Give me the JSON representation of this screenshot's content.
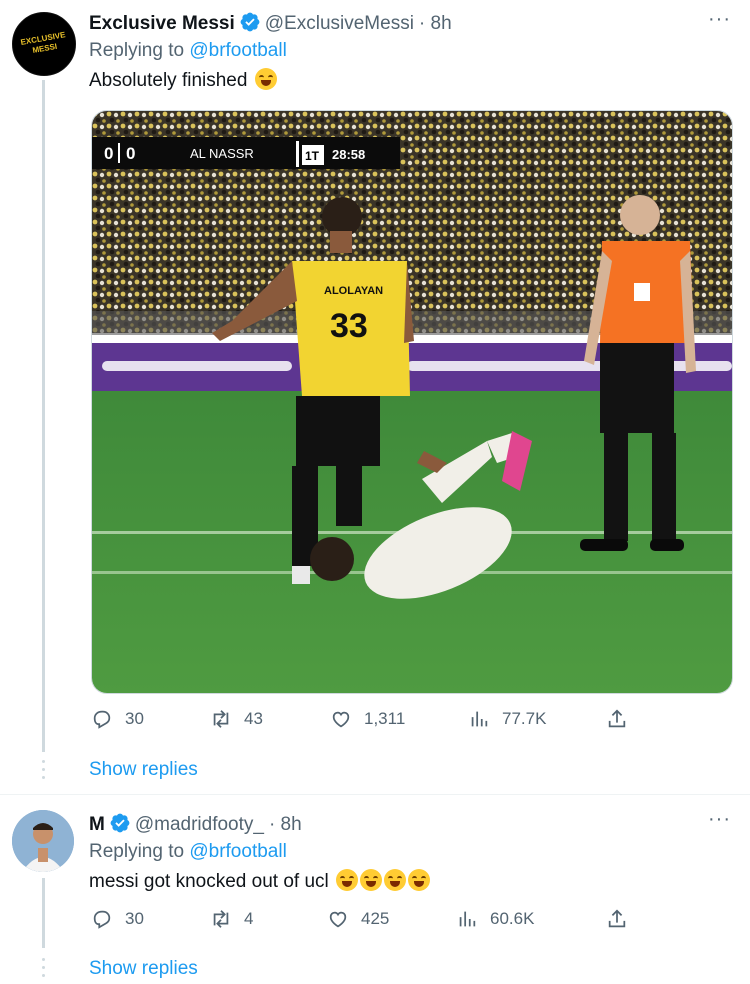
{
  "tweets": [
    {
      "display_name": "Exclusive Messi",
      "handle": "@ExclusiveMessi",
      "time": "· 8h",
      "reply_prefix": "Replying to ",
      "reply_to": "@brfootball",
      "text": "Absolutely finished",
      "avatar_text_line1": "EXCLUSIVE",
      "avatar_text_line2": "MESSI",
      "media": {
        "scoreboard_home": "0",
        "scoreboard_away": "0",
        "scoreboard_team": "AL NASSR",
        "scoreboard_period": "1T",
        "scoreboard_clock": "28:58",
        "player_name": "ALOLAYAN",
        "player_number": "33"
      },
      "stats": {
        "replies": "30",
        "retweets": "43",
        "likes": "1,311",
        "views": "77.7K"
      },
      "show_replies": "Show replies"
    },
    {
      "display_name": "M",
      "handle": "@madridfooty_",
      "time": "· 8h",
      "reply_prefix": "Replying to ",
      "reply_to": "@brfootball",
      "text": "messi got knocked out of ucl",
      "stats": {
        "replies": "30",
        "retweets": "4",
        "likes": "425",
        "views": "60.6K"
      },
      "show_replies": "Show replies"
    }
  ],
  "icons": {
    "verified": "verified-badge-icon",
    "reply": "reply-icon",
    "retweet": "retweet-icon",
    "like": "heart-icon",
    "views": "views-icon",
    "share": "share-icon",
    "more": "more-icon"
  },
  "colors": {
    "link": "#1d9bf0",
    "muted": "#536471",
    "text": "#0f1419",
    "thread_line": "#cfd9de"
  }
}
